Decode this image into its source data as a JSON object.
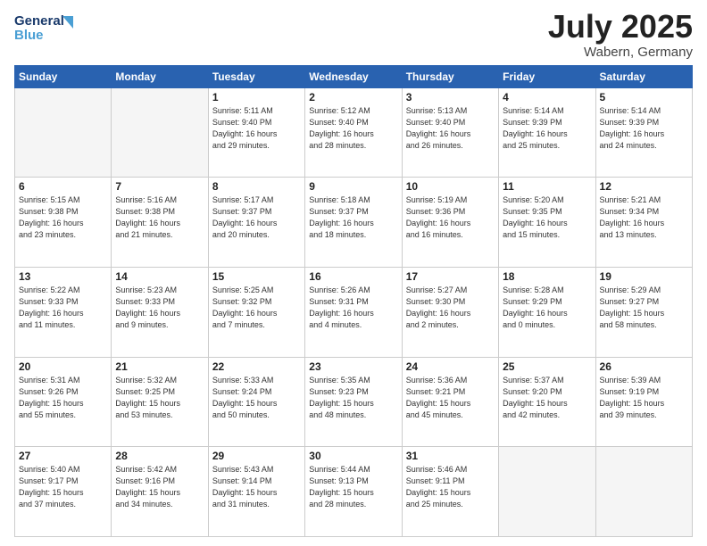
{
  "header": {
    "logo_line1": "General",
    "logo_line2": "Blue",
    "month": "July 2025",
    "location": "Wabern, Germany"
  },
  "days_of_week": [
    "Sunday",
    "Monday",
    "Tuesday",
    "Wednesday",
    "Thursday",
    "Friday",
    "Saturday"
  ],
  "weeks": [
    [
      {
        "date": "",
        "info": ""
      },
      {
        "date": "",
        "info": ""
      },
      {
        "date": "1",
        "info": "Sunrise: 5:11 AM\nSunset: 9:40 PM\nDaylight: 16 hours\nand 29 minutes."
      },
      {
        "date": "2",
        "info": "Sunrise: 5:12 AM\nSunset: 9:40 PM\nDaylight: 16 hours\nand 28 minutes."
      },
      {
        "date": "3",
        "info": "Sunrise: 5:13 AM\nSunset: 9:40 PM\nDaylight: 16 hours\nand 26 minutes."
      },
      {
        "date": "4",
        "info": "Sunrise: 5:14 AM\nSunset: 9:39 PM\nDaylight: 16 hours\nand 25 minutes."
      },
      {
        "date": "5",
        "info": "Sunrise: 5:14 AM\nSunset: 9:39 PM\nDaylight: 16 hours\nand 24 minutes."
      }
    ],
    [
      {
        "date": "6",
        "info": "Sunrise: 5:15 AM\nSunset: 9:38 PM\nDaylight: 16 hours\nand 23 minutes."
      },
      {
        "date": "7",
        "info": "Sunrise: 5:16 AM\nSunset: 9:38 PM\nDaylight: 16 hours\nand 21 minutes."
      },
      {
        "date": "8",
        "info": "Sunrise: 5:17 AM\nSunset: 9:37 PM\nDaylight: 16 hours\nand 20 minutes."
      },
      {
        "date": "9",
        "info": "Sunrise: 5:18 AM\nSunset: 9:37 PM\nDaylight: 16 hours\nand 18 minutes."
      },
      {
        "date": "10",
        "info": "Sunrise: 5:19 AM\nSunset: 9:36 PM\nDaylight: 16 hours\nand 16 minutes."
      },
      {
        "date": "11",
        "info": "Sunrise: 5:20 AM\nSunset: 9:35 PM\nDaylight: 16 hours\nand 15 minutes."
      },
      {
        "date": "12",
        "info": "Sunrise: 5:21 AM\nSunset: 9:34 PM\nDaylight: 16 hours\nand 13 minutes."
      }
    ],
    [
      {
        "date": "13",
        "info": "Sunrise: 5:22 AM\nSunset: 9:33 PM\nDaylight: 16 hours\nand 11 minutes."
      },
      {
        "date": "14",
        "info": "Sunrise: 5:23 AM\nSunset: 9:33 PM\nDaylight: 16 hours\nand 9 minutes."
      },
      {
        "date": "15",
        "info": "Sunrise: 5:25 AM\nSunset: 9:32 PM\nDaylight: 16 hours\nand 7 minutes."
      },
      {
        "date": "16",
        "info": "Sunrise: 5:26 AM\nSunset: 9:31 PM\nDaylight: 16 hours\nand 4 minutes."
      },
      {
        "date": "17",
        "info": "Sunrise: 5:27 AM\nSunset: 9:30 PM\nDaylight: 16 hours\nand 2 minutes."
      },
      {
        "date": "18",
        "info": "Sunrise: 5:28 AM\nSunset: 9:29 PM\nDaylight: 16 hours\nand 0 minutes."
      },
      {
        "date": "19",
        "info": "Sunrise: 5:29 AM\nSunset: 9:27 PM\nDaylight: 15 hours\nand 58 minutes."
      }
    ],
    [
      {
        "date": "20",
        "info": "Sunrise: 5:31 AM\nSunset: 9:26 PM\nDaylight: 15 hours\nand 55 minutes."
      },
      {
        "date": "21",
        "info": "Sunrise: 5:32 AM\nSunset: 9:25 PM\nDaylight: 15 hours\nand 53 minutes."
      },
      {
        "date": "22",
        "info": "Sunrise: 5:33 AM\nSunset: 9:24 PM\nDaylight: 15 hours\nand 50 minutes."
      },
      {
        "date": "23",
        "info": "Sunrise: 5:35 AM\nSunset: 9:23 PM\nDaylight: 15 hours\nand 48 minutes."
      },
      {
        "date": "24",
        "info": "Sunrise: 5:36 AM\nSunset: 9:21 PM\nDaylight: 15 hours\nand 45 minutes."
      },
      {
        "date": "25",
        "info": "Sunrise: 5:37 AM\nSunset: 9:20 PM\nDaylight: 15 hours\nand 42 minutes."
      },
      {
        "date": "26",
        "info": "Sunrise: 5:39 AM\nSunset: 9:19 PM\nDaylight: 15 hours\nand 39 minutes."
      }
    ],
    [
      {
        "date": "27",
        "info": "Sunrise: 5:40 AM\nSunset: 9:17 PM\nDaylight: 15 hours\nand 37 minutes."
      },
      {
        "date": "28",
        "info": "Sunrise: 5:42 AM\nSunset: 9:16 PM\nDaylight: 15 hours\nand 34 minutes."
      },
      {
        "date": "29",
        "info": "Sunrise: 5:43 AM\nSunset: 9:14 PM\nDaylight: 15 hours\nand 31 minutes."
      },
      {
        "date": "30",
        "info": "Sunrise: 5:44 AM\nSunset: 9:13 PM\nDaylight: 15 hours\nand 28 minutes."
      },
      {
        "date": "31",
        "info": "Sunrise: 5:46 AM\nSunset: 9:11 PM\nDaylight: 15 hours\nand 25 minutes."
      },
      {
        "date": "",
        "info": ""
      },
      {
        "date": "",
        "info": ""
      }
    ]
  ]
}
